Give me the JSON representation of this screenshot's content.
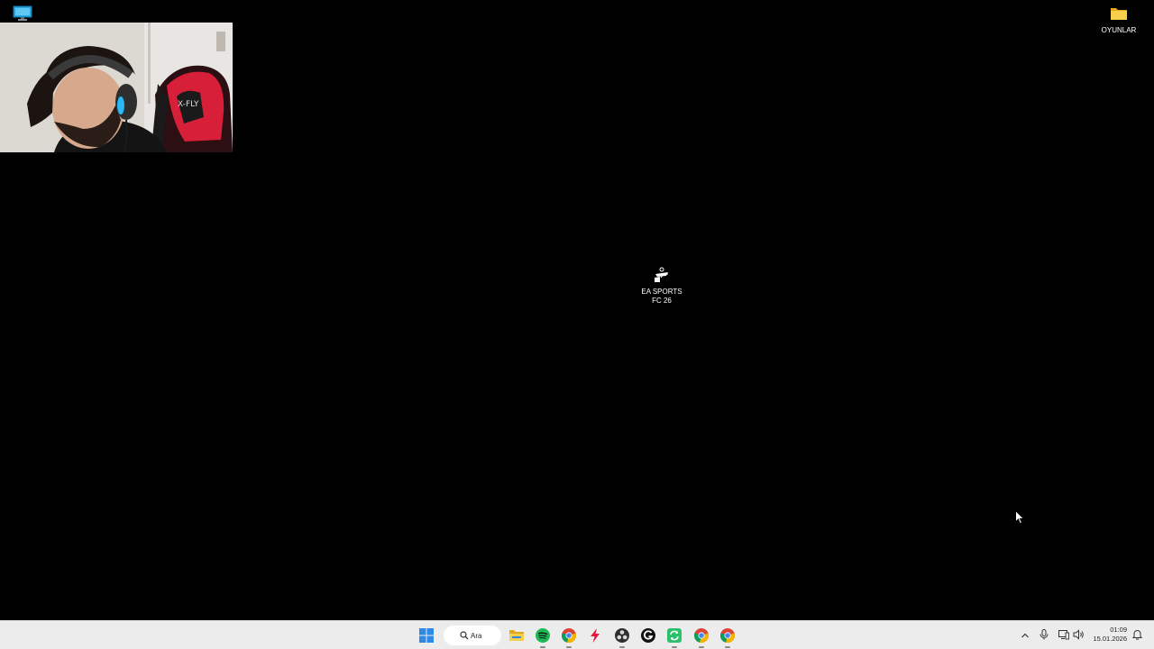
{
  "desktop": {
    "icons": [
      {
        "label": "OYUNLAR",
        "icon": "folder-icon"
      },
      {
        "label_line1": "EA SPORTS",
        "label_line2": "FC 26",
        "icon": "ea-fc-icon"
      }
    ],
    "top_left_icon": "this-pc-monitor-icon"
  },
  "webcam": {
    "description_icon": "webcam-overlay"
  },
  "taskbar": {
    "search": {
      "label": "Ara",
      "icon": "search-icon"
    },
    "apps": [
      {
        "name": "start",
        "icon": "windows-start-icon"
      },
      {
        "name": "file-explorer",
        "icon": "folder-icon",
        "running": false
      },
      {
        "name": "spotify",
        "icon": "spotify-icon",
        "running": true
      },
      {
        "name": "chrome",
        "icon": "chrome-icon",
        "running": true
      },
      {
        "name": "lightning-app",
        "icon": "lightning-icon",
        "running": false
      },
      {
        "name": "obs",
        "icon": "obs-icon",
        "running": true
      },
      {
        "name": "g-app",
        "icon": "g-icon",
        "running": false
      },
      {
        "name": "green-app",
        "icon": "green-sync-icon",
        "running": true
      },
      {
        "name": "chrome-2",
        "icon": "chrome-icon",
        "running": true
      },
      {
        "name": "chrome-3",
        "icon": "chrome-icon",
        "running": true
      }
    ],
    "tray": {
      "icons": [
        "chevron-up-icon",
        "microphone-icon",
        "network-icon",
        "volume-icon",
        "notification-icon"
      ],
      "time": "01:09",
      "date": "15.01.2026"
    }
  },
  "colors": {
    "desktop_bg": "#000000",
    "taskbar_bg": "#ececec",
    "windows_blue": "#2f8ae5",
    "spotify_green": "#1db954",
    "folder_yellow": "#f3c13a"
  }
}
